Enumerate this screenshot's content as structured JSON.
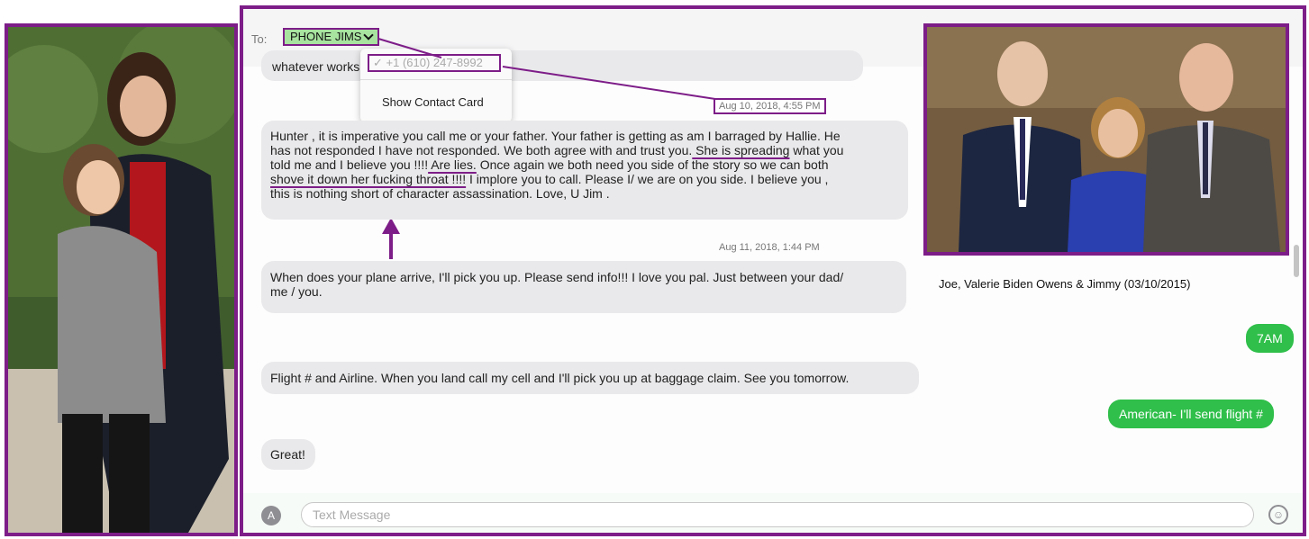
{
  "recipient": {
    "to_label": "To:",
    "name": "PHONE JIMS",
    "phone": "✓ +1 (610) 247-8992",
    "show_contact_card": "Show Contact Card"
  },
  "messages": {
    "partial_text": "whatever works",
    "ts1": "Aug 10, 2018, 4:55 PM",
    "m1_lines": [
      "Hunter , it is imperative you call me or your father. Your father is getting as am I barraged by Hallie. He",
      "has not responded I have not responded. We both agree with and trust you."
    ],
    "m1_part_a": " She is spreading",
    "m1_part_b": " what you",
    "m1_line3_a": "told me and I believe you !!!!",
    "m1_line3_b": " Are lies.",
    "m1_line3_c": "  Once again we both need you side of the story so we can both",
    "m1_line4_a": "shove it down her fucking throat !!!!",
    "m1_line4_b": " I implore you to call.    Please I/ we are on you side. I believe you ,",
    "m1_line5": "this is nothing short of character assassination. Love, U Jim .",
    "ts2": "Aug 11, 2018, 1:44 PM",
    "m2_line1": "When does your plane arrive, I'll pick you up. Please send info!!! I love you pal. Just between your dad/",
    "m2_line2": "me / you.",
    "sent1": "7AM",
    "m3": "Flight # and Airline. When you land call my cell and I'll pick you up at baggage claim.  See you tomorrow.",
    "sent2": "American- I'll send flight #",
    "m4": "Great!"
  },
  "photo_caption": "Joe, Valerie Biden Owens & Jimmy (03/10/2015)",
  "input": {
    "placeholder": "Text Message",
    "app_icon": "app-store-icon",
    "emoji_icon": "emoji-icon"
  },
  "colors": {
    "annotation": "#7d1d88",
    "sent_bubble": "#2fbf4a",
    "received_bubble": "#e9e9eb",
    "recipient_chip": "#a8e4a0"
  }
}
